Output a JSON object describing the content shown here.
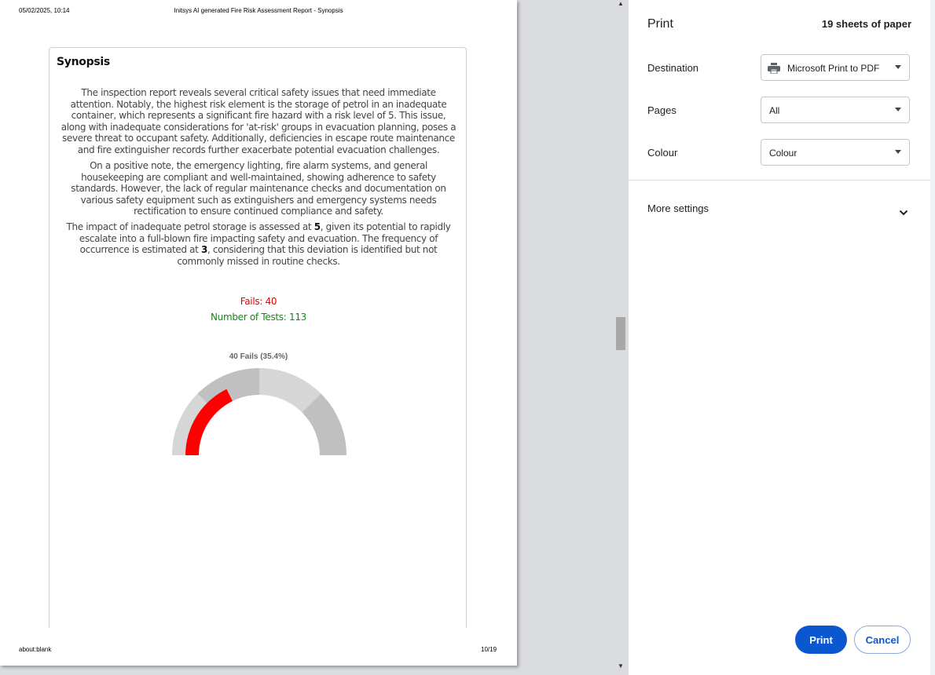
{
  "page_header": {
    "datetime": "05/02/2025, 10:14",
    "title": "Initsys AI generated Fire Risk Assessment Report - Synopsis"
  },
  "page_footer": {
    "url": "about:blank",
    "page_number": "10/19"
  },
  "synopsis": {
    "title": "Synopsis",
    "paragraph1": "The inspection report reveals several critical safety issues that need immediate attention. Notably, the highest risk element is the storage of petrol in an inadequate container, which represents a significant fire hazard with a risk level of 5. This issue, along with inadequate considerations for 'at-risk' groups in evacuation planning, poses a severe threat to occupant safety. Additionally, deficiencies in escape route maintenance and fire extinguisher records further exacerbate potential evacuation challenges.",
    "paragraph2": "On a positive note, the emergency lighting, fire alarm systems, and general housekeeping are compliant and well-maintained, showing adherence to safety standards. However, the lack of regular maintenance checks and documentation on various safety equipment such as extinguishers and emergency systems needs rectification to ensure continued compliance and safety.",
    "paragraph3_a": "The impact of inadequate petrol storage is assessed at ",
    "paragraph3_impact": "5",
    "paragraph3_b": ", given its potential to rapidly escalate into a full-blown fire impacting safety and evacuation. The frequency of occurrence is estimated at ",
    "paragraph3_frequency": "3",
    "paragraph3_c": ", considering that this deviation is identified but not commonly missed in routine checks.",
    "fails_text": "Fails: 40",
    "tests_text": "Number of Tests: 113"
  },
  "chart_data": {
    "type": "gauge",
    "title": "40 Fails (35.4%)",
    "fails": 40,
    "total": 113,
    "fraction": 0.354,
    "range": [
      0,
      113
    ],
    "colors": {
      "value": "#ff0000",
      "track_light": "#d6d6d6",
      "track_dark": "#c0c0c0"
    }
  },
  "print_panel": {
    "title": "Print",
    "sheets": "19 sheets of paper",
    "destination_label": "Destination",
    "destination_value": "Microsoft Print to PDF",
    "pages_label": "Pages",
    "pages_value": "All",
    "colour_label": "Colour",
    "colour_value": "Colour",
    "more_settings_label": "More settings",
    "print_button": "Print",
    "cancel_button": "Cancel",
    "accent_color": "#0b57d0"
  },
  "icons": {
    "printer": "printer-icon",
    "dropdown": "caret-down-icon",
    "more": "chevron-down-icon",
    "scroll_up": "scroll-up-arrow-icon",
    "scroll_down": "scroll-down-arrow-icon"
  }
}
